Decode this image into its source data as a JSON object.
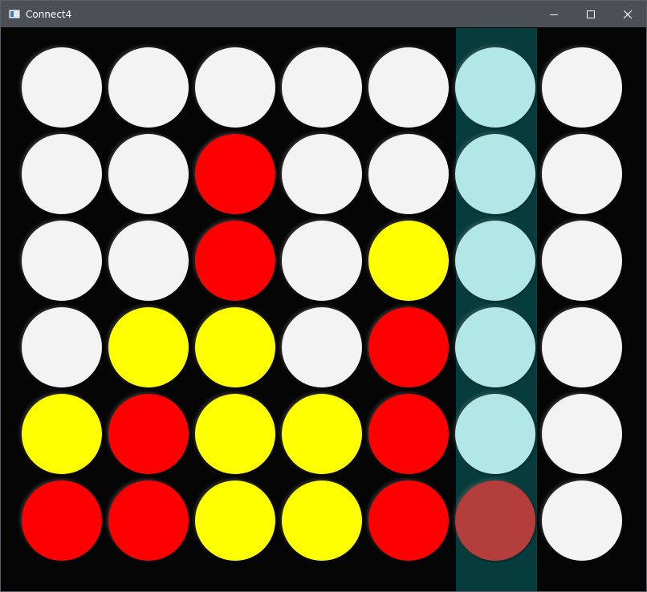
{
  "window": {
    "title": "Connect4",
    "icon": "app-window-icon",
    "controls": [
      "minimize-icon",
      "maximize-icon",
      "close-icon"
    ]
  },
  "game": {
    "rows": 6,
    "columns": 7,
    "hover_column": 5,
    "colors": {
      "empty": "#f3f3f3",
      "red": "#ff0000",
      "yellow": "#ffff00",
      "hover_empty": "#b1e7e7",
      "hover_red": "#b33e3b",
      "hover_column_bg": "#063c3c",
      "board_bg": "#050505"
    },
    "grid": [
      [
        "empty",
        "empty",
        "empty",
        "empty",
        "empty",
        "empty",
        "empty"
      ],
      [
        "empty",
        "empty",
        "red",
        "empty",
        "empty",
        "empty",
        "empty"
      ],
      [
        "empty",
        "empty",
        "red",
        "empty",
        "yellow",
        "empty",
        "empty"
      ],
      [
        "empty",
        "yellow",
        "yellow",
        "empty",
        "red",
        "empty",
        "empty"
      ],
      [
        "yellow",
        "red",
        "yellow",
        "yellow",
        "red",
        "empty",
        "empty"
      ],
      [
        "red",
        "red",
        "yellow",
        "yellow",
        "red",
        "red",
        "empty"
      ]
    ]
  }
}
